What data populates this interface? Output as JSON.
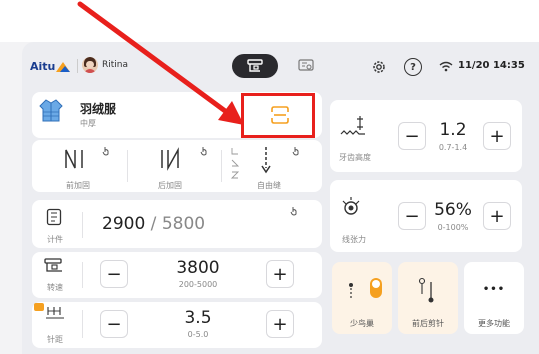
{
  "status_bar": {
    "brand": "Aitu",
    "user": "Ritina",
    "time": "11/20 14:35"
  },
  "fabric": {
    "name": "羽绒服",
    "sub": "中厚"
  },
  "stitch_modes": [
    {
      "label": "前加固"
    },
    {
      "label": "后加固"
    },
    {
      "label": "自由缝"
    }
  ],
  "count": {
    "label": "计件",
    "current": "2900",
    "separator": " / ",
    "target": "5800"
  },
  "speed": {
    "label": "转速",
    "value": "3800",
    "range": "200-5000"
  },
  "stitch_len": {
    "label": "针距",
    "value": "3.5",
    "range": "0-5.0"
  },
  "tooth_height": {
    "label": "牙齿高度",
    "value": "1.2",
    "range": "0.7-1.4"
  },
  "tension": {
    "label": "线张力",
    "value": "56%",
    "range": "0-100%"
  },
  "functions": [
    {
      "label": "少鸟巢"
    },
    {
      "label": "前后剪针"
    },
    {
      "label": "更多功能"
    }
  ],
  "controls": {
    "minus": "−",
    "plus": "+",
    "more": "•••"
  },
  "colors": {
    "accent": "#f5a020",
    "annotation": "#e8201c",
    "dark": "#2a2a2e"
  }
}
